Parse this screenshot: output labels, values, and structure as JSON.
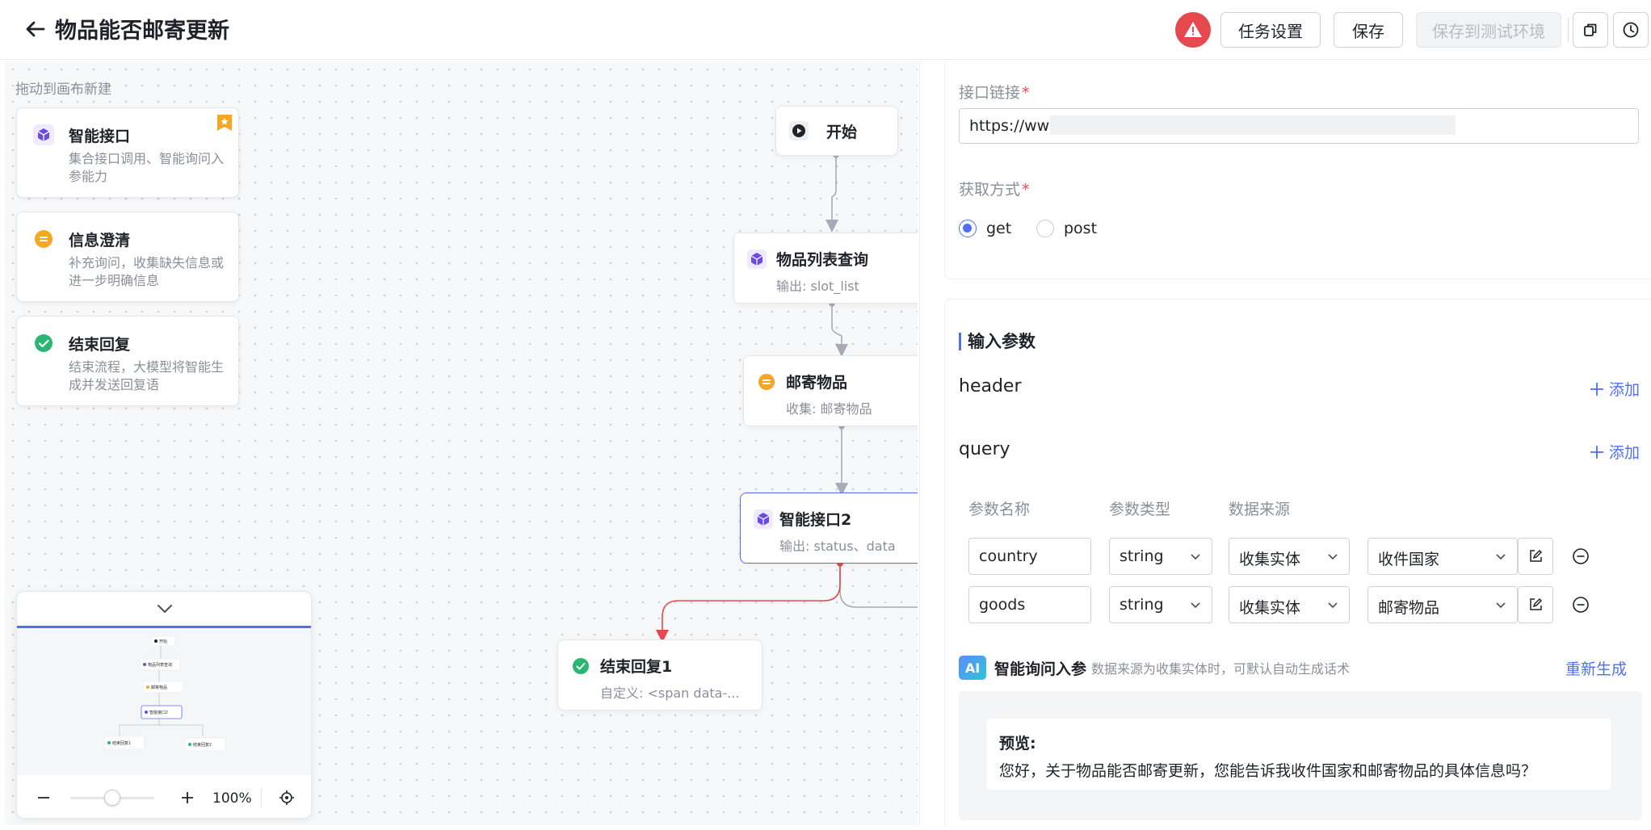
{
  "header": {
    "title": "物品能否邮寄更新",
    "buttons": {
      "task_settings": "任务设置",
      "save": "保存",
      "save_to_test": "保存到测试环境"
    }
  },
  "canvas": {
    "hint": "拖动到画布新建",
    "palette": [
      {
        "title": "智能接口",
        "desc": "集合接口调用、智能询问入参能力"
      },
      {
        "title": "信息澄清",
        "desc": "补充询问，收集缺失信息或进一步明确信息"
      },
      {
        "title": "结束回复",
        "desc": "结束流程，大模型将智能生成并发送回复语"
      }
    ],
    "nodes": {
      "start": {
        "title": "开始"
      },
      "list_query": {
        "title": "物品列表查询",
        "sub": "输出: slot_list"
      },
      "mail_item": {
        "title": "邮寄物品",
        "sub": "收集: 邮寄物品"
      },
      "api2": {
        "title": "智能接口2",
        "sub": "输出: status、data"
      },
      "end1": {
        "title": "结束回复1",
        "sub": "自定义: <span data-..."
      }
    },
    "minimap": {
      "zoom": "100%",
      "labels": [
        "开始",
        "物品列表查询",
        "邮寄物品",
        "智能接口2",
        "结束回复1",
        "结束回复2"
      ]
    }
  },
  "colors": {
    "accent": "#4f6ef7",
    "danger": "#e5484d",
    "api_node": "#6c4ce0",
    "clarify_node": "#f5a623",
    "end_node": "#2bb673"
  },
  "panel": {
    "url_label": "接口链接",
    "url_value": "https://www",
    "method_label": "获取方式",
    "methods": [
      {
        "label": "get",
        "checked": true
      },
      {
        "label": "post",
        "checked": false
      }
    ],
    "input_section": "输入参数",
    "header_group": "header",
    "query_group": "query",
    "add_label": "添加",
    "columns": [
      "参数名称",
      "参数类型",
      "数据来源"
    ],
    "rows": [
      {
        "name": "country",
        "type": "string",
        "source": "收集实体",
        "entity": "收件国家"
      },
      {
        "name": "goods",
        "type": "string",
        "source": "收集实体",
        "entity": "邮寄物品"
      }
    ],
    "ai": {
      "badge": "AI",
      "title": "智能询问入参",
      "hint": "数据来源为收集实体时，可默认自动生成话术",
      "regenerate": "重新生成",
      "preview_label": "预览:",
      "preview_text": "您好，关于物品能否邮寄更新，您能告诉我收件国家和邮寄物品的具体信息吗？"
    }
  }
}
